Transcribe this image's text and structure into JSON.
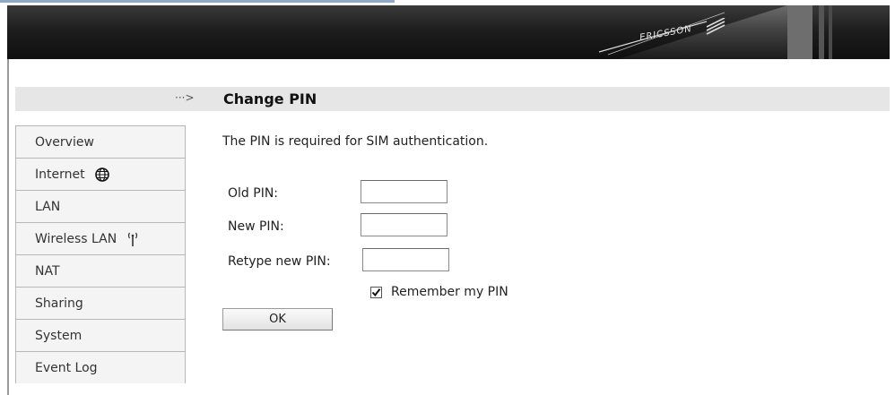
{
  "header": {
    "brand": "ERICSSON"
  },
  "page": {
    "title": "Change PIN",
    "arrow": "···>",
    "description": "The PIN is required for SIM authentication."
  },
  "sidebar": {
    "items": [
      {
        "label": "Overview",
        "icon": null
      },
      {
        "label": "Internet",
        "icon": "globe-icon"
      },
      {
        "label": "LAN",
        "icon": null
      },
      {
        "label": "Wireless LAN",
        "icon": "wireless-antenna-icon"
      },
      {
        "label": "NAT",
        "icon": null
      },
      {
        "label": "Sharing",
        "icon": null
      },
      {
        "label": "System",
        "icon": null
      },
      {
        "label": "Event Log",
        "icon": null
      }
    ]
  },
  "form": {
    "old_pin_label": "Old PIN:",
    "old_pin_value": "",
    "new_pin_label": "New PIN:",
    "new_pin_value": "",
    "retype_pin_label": "Retype new PIN:",
    "retype_pin_value": "",
    "remember_label": "Remember my PIN",
    "remember_checked": true,
    "ok_label": "OK"
  }
}
